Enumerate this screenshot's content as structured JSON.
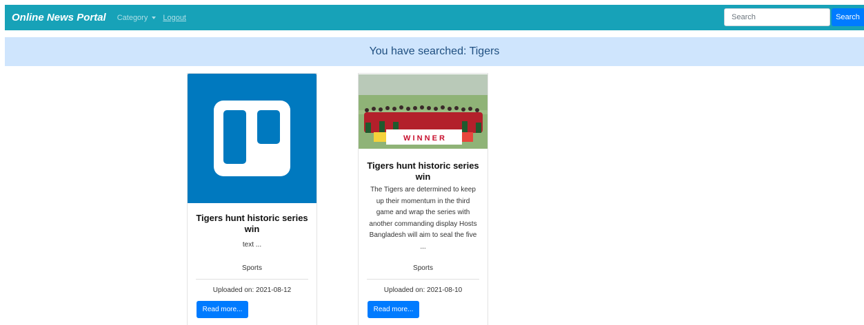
{
  "navbar": {
    "brand": "Online News Portal",
    "category_label": "Category",
    "logout_label": "Logout",
    "search_placeholder": "Search",
    "search_button_label": "Search"
  },
  "banner": {
    "text": "You have searched: Tigers"
  },
  "cards": [
    {
      "image_icon": "trello-logo-icon",
      "title": "Tigers hunt historic series win",
      "text": "text ...",
      "category": "Sports",
      "uploaded": "Uploaded on: 2021-08-12",
      "button_label": "Read more..."
    },
    {
      "image_icon": "cricket-team-photo",
      "image_sign": "W I N N E R",
      "title": "Tigers hunt historic series win",
      "text": "The Tigers are determined to keep up their momentum in the third game and wrap the series with another commanding display Hosts Bangladesh will aim to seal the five ...",
      "category": "Sports",
      "uploaded": "Uploaded on: 2021-08-10",
      "button_label": "Read more..."
    }
  ],
  "colors": {
    "navbar": "#17a2b8",
    "primary": "#007bff",
    "banner": "#cfe5fd",
    "trello_blue": "#0079bf"
  }
}
